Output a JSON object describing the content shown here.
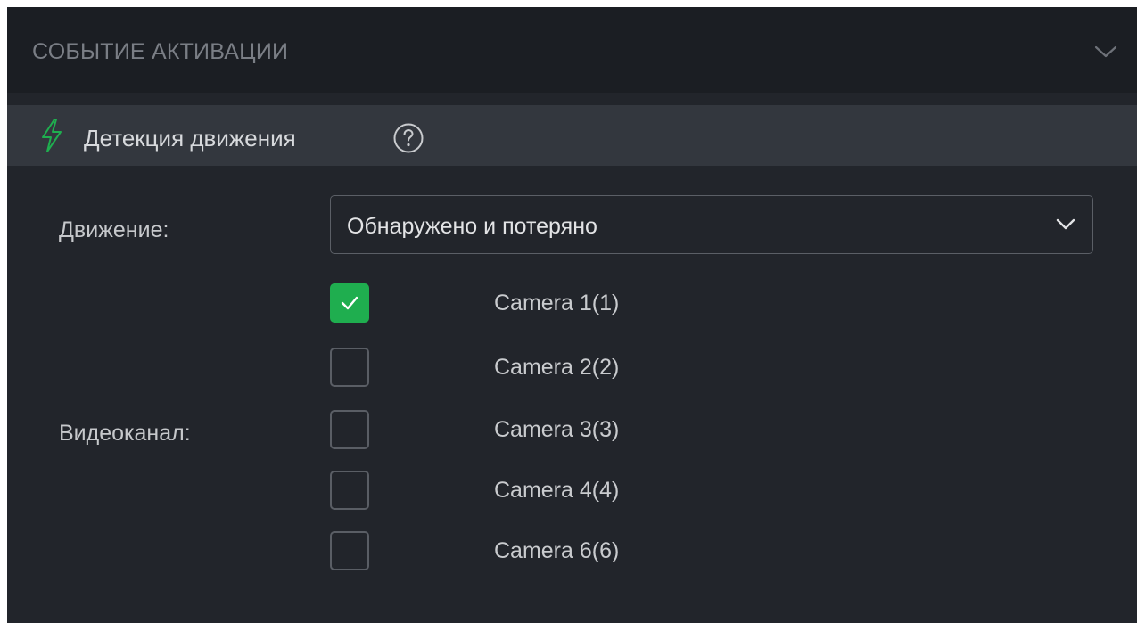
{
  "panel": {
    "title": "СОБЫТИЕ АКТИВАЦИИ",
    "collapse_icon": "chevron-down-icon"
  },
  "section": {
    "icon": "bolt-icon",
    "icon_color": "#1fae4f",
    "title": "Детекция движения",
    "help_icon": "question-circle-icon"
  },
  "form": {
    "motion_label": "Движение:",
    "motion_value": "Обнаружено и потеряно",
    "channel_label": "Видеоканал:"
  },
  "channels": [
    {
      "label": "Camera 1(1)",
      "checked": true
    },
    {
      "label": "Camera 2(2)",
      "checked": false
    },
    {
      "label": "Camera 3(3)",
      "checked": false
    },
    {
      "label": "Camera 4(4)",
      "checked": false
    },
    {
      "label": "Camera 6(6)",
      "checked": false
    }
  ],
  "colors": {
    "accent": "#1fae4f",
    "background": "#22252b",
    "header_background": "#1b1e23",
    "section_background": "#33373e"
  }
}
